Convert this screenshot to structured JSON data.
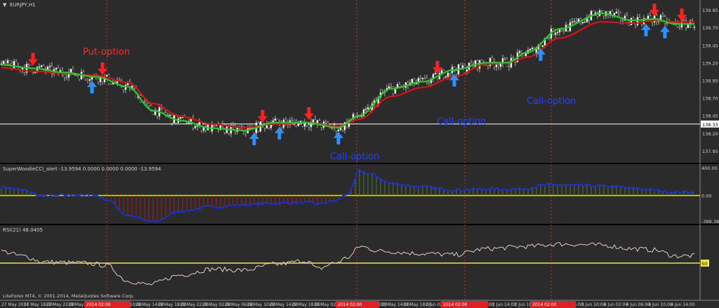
{
  "window": {
    "title": "EURJPY,H1",
    "copyright": "LiteForex MT4, © 2001-2014, MetaQuotes Software Corp."
  },
  "annotations": {
    "put_option": "Put-option",
    "call_option_1": "Call-option",
    "call_option_2": "Call-option",
    "call_option_3": "Call-option"
  },
  "colors": {
    "background": "#2b2b2b",
    "grid": "#9a9a9a",
    "bull_candle": "#ffffff",
    "bear_candle": "#000000",
    "fast_ma": "#22cc22",
    "slow_ma": "#dd1111",
    "put_arrow": "#ff2020",
    "call_arrow": "#2f8fff",
    "cci_line": "#1a2fe0",
    "cci_bar_up": "#4a7a3a",
    "cci_bar_down": "#a02020",
    "zero_line": "#e8e840",
    "rsi_line": "#d9cfc0",
    "current_price_line": "#ffffff",
    "annotation_put": "#ff2a2a",
    "annotation_call": "#2040ff"
  },
  "chart_data": [
    {
      "type": "candlestick",
      "panel": "price",
      "symbol": "EURJPY",
      "timeframe": "H1",
      "ylim": [
        137.8,
        140.05
      ],
      "yticks": [
        "139.95",
        "139.70",
        "139.45",
        "139.20",
        "138.95",
        "138.70",
        "138.45",
        "138.20",
        "137.95"
      ],
      "current_price_label": "138.33",
      "current_price": 138.33,
      "ma_fast_anchors": [
        [
          0,
          139.17
        ],
        [
          15,
          139.12
        ],
        [
          30,
          139.06
        ],
        [
          45,
          139.0
        ],
        [
          60,
          138.86
        ],
        [
          72,
          138.52
        ],
        [
          85,
          138.38
        ],
        [
          100,
          138.27
        ],
        [
          115,
          138.24
        ],
        [
          130,
          138.35
        ],
        [
          145,
          138.35
        ],
        [
          160,
          138.28
        ],
        [
          170,
          138.45
        ],
        [
          185,
          138.83
        ],
        [
          200,
          138.93
        ],
        [
          215,
          139.1
        ],
        [
          230,
          139.2
        ],
        [
          240,
          139.2
        ],
        [
          250,
          139.35
        ],
        [
          265,
          139.68
        ],
        [
          285,
          139.9
        ],
        [
          300,
          139.8
        ],
        [
          310,
          139.82
        ],
        [
          320,
          139.75
        ]
      ],
      "ma_slow_anchors": [
        [
          0,
          139.13
        ],
        [
          15,
          139.08
        ],
        [
          30,
          139.05
        ],
        [
          45,
          139.02
        ],
        [
          60,
          138.92
        ],
        [
          72,
          138.62
        ],
        [
          85,
          138.44
        ],
        [
          100,
          138.33
        ],
        [
          115,
          138.28
        ],
        [
          130,
          138.33
        ],
        [
          145,
          138.35
        ],
        [
          160,
          138.3
        ],
        [
          170,
          138.4
        ],
        [
          185,
          138.72
        ],
        [
          200,
          138.85
        ],
        [
          215,
          139.0
        ],
        [
          230,
          139.18
        ],
        [
          240,
          139.2
        ],
        [
          250,
          139.28
        ],
        [
          265,
          139.55
        ],
        [
          285,
          139.78
        ],
        [
          300,
          139.76
        ],
        [
          310,
          139.8
        ],
        [
          320,
          139.78
        ]
      ],
      "signals": [
        {
          "type": "put",
          "bar": 15
        },
        {
          "type": "put",
          "bar": 48
        },
        {
          "type": "call",
          "bar": 43
        },
        {
          "type": "call",
          "bar": 120
        },
        {
          "type": "call",
          "bar": 132
        },
        {
          "type": "put",
          "bar": 124
        },
        {
          "type": "put",
          "bar": 146
        },
        {
          "type": "call",
          "bar": 160
        },
        {
          "type": "put",
          "bar": 207
        },
        {
          "type": "call",
          "bar": 215
        },
        {
          "type": "call",
          "bar": 256
        },
        {
          "type": "call",
          "bar": 306
        },
        {
          "type": "call",
          "bar": 315
        },
        {
          "type": "put",
          "bar": 310
        },
        {
          "type": "put",
          "bar": 323
        }
      ]
    },
    {
      "type": "bar+line",
      "panel": "cci",
      "title": "SuperWoodieCCI_alert -13.9594 0.0000 0.0000 0.0000 -13.9594",
      "ylim": [
        -388.38,
        400.0
      ],
      "yticks": [
        "400.00",
        "0.00",
        "-388.38"
      ],
      "zero_level": 0,
      "anchors": [
        [
          0,
          120
        ],
        [
          10,
          80
        ],
        [
          20,
          -10
        ],
        [
          30,
          5
        ],
        [
          45,
          0
        ],
        [
          50,
          -60
        ],
        [
          60,
          -280
        ],
        [
          72,
          -370
        ],
        [
          85,
          -220
        ],
        [
          100,
          -160
        ],
        [
          115,
          -130
        ],
        [
          130,
          -110
        ],
        [
          145,
          -100
        ],
        [
          150,
          -120
        ],
        [
          158,
          -80
        ],
        [
          165,
          30
        ],
        [
          170,
          350
        ],
        [
          175,
          300
        ],
        [
          185,
          170
        ],
        [
          200,
          120
        ],
        [
          215,
          80
        ],
        [
          230,
          90
        ],
        [
          245,
          90
        ],
        [
          260,
          150
        ],
        [
          275,
          140
        ],
        [
          290,
          130
        ],
        [
          300,
          100
        ],
        [
          320,
          50
        ]
      ]
    },
    {
      "type": "line",
      "panel": "rsi",
      "title": "RSI(21) 48.0405",
      "ylim": [
        20,
        80
      ],
      "level_label": "50",
      "level": 50,
      "anchors": [
        [
          0,
          60
        ],
        [
          10,
          56
        ],
        [
          20,
          51
        ],
        [
          40,
          50
        ],
        [
          50,
          48
        ],
        [
          60,
          35
        ],
        [
          70,
          32
        ],
        [
          85,
          40
        ],
        [
          100,
          45
        ],
        [
          115,
          44
        ],
        [
          130,
          49
        ],
        [
          145,
          52
        ],
        [
          150,
          45
        ],
        [
          158,
          50
        ],
        [
          165,
          55
        ],
        [
          170,
          64
        ],
        [
          180,
          60
        ],
        [
          200,
          58
        ],
        [
          215,
          57
        ],
        [
          230,
          62
        ],
        [
          250,
          64
        ],
        [
          265,
          66
        ],
        [
          285,
          65
        ],
        [
          300,
          62
        ],
        [
          310,
          61
        ],
        [
          320,
          56
        ]
      ]
    }
  ],
  "time_axis": {
    "labels": [
      "27 May 2014",
      "27 May 18:00",
      "27 May 22:00",
      "28 May 02:00",
      "28 May 06:00",
      "28 May 10:00",
      "28 May 14:00",
      "28 May 18:00",
      "28 May 22:00",
      "29 May 02:00",
      "29 May 06:00",
      "29 May 10:00",
      "29 May 14:00",
      "29 May 18:00",
      "30 May 02:00",
      "30 May 06:00",
      "30 May 10:00",
      "30 May 14:00",
      "30 May 18:00",
      "2 Jun 02:00",
      "2 Jun 06:00",
      "2 Jun 10:00",
      "2 Jun 14:00",
      "2 Jun 18:00",
      "3 Jun 02:00",
      "3 Jun 06:00",
      "3 Jun 10:00",
      "4 Jun 02:00",
      "4 Jun 06:00",
      "4 Jun 10:00",
      "4 Jun 14:00"
    ],
    "highlighted_labels": [
      "2014 02:00",
      "2014 02:00",
      "2014 02:00",
      "2014 02:00"
    ]
  }
}
